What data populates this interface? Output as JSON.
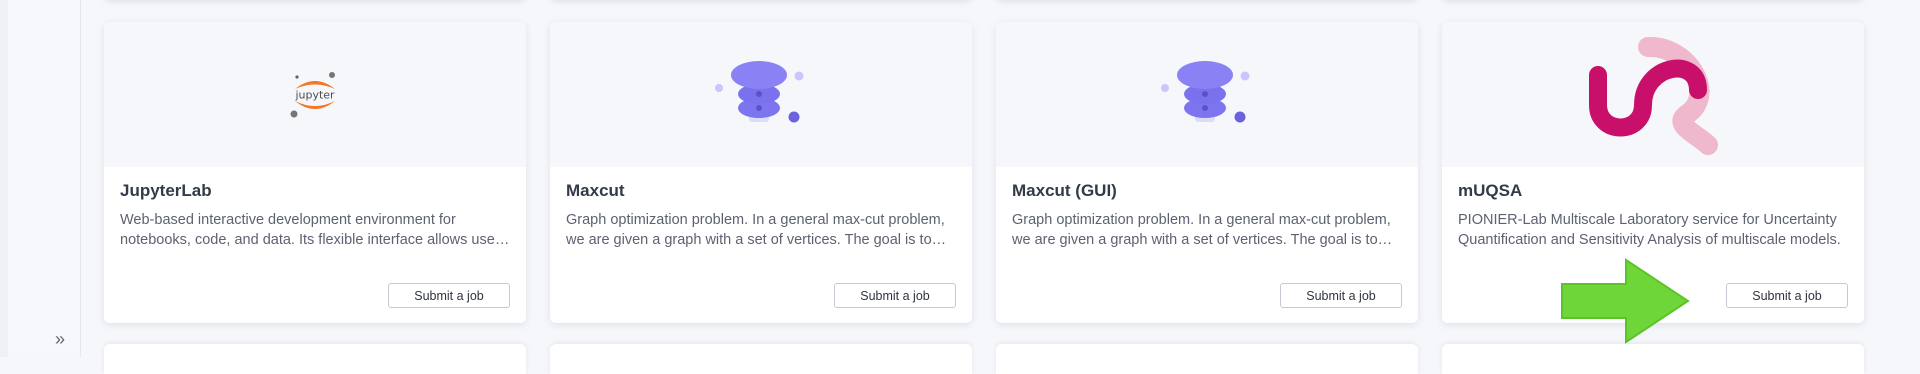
{
  "sidebar": {
    "expand_icon": "double-chevron-right-icon",
    "expand_glyph": "»"
  },
  "cards": [
    {
      "title": "JupyterLab",
      "description": "Web-based interactive development environment for notebooks, code, and data. Its flexible interface allows users to configure and arrange workflows.",
      "logo_text": "jupyter",
      "button_label": "Submit a job",
      "icon": "jupyter-logo-icon"
    },
    {
      "title": "Maxcut",
      "description": "Graph optimization problem. In a general max-cut problem, we are given a graph with a set of vertices. The goal is to partition them.",
      "button_label": "Submit a job",
      "icon": "quantum-stack-icon"
    },
    {
      "title": "Maxcut (GUI)",
      "description": "Graph optimization problem. In a general max-cut problem, we are given a graph with a set of vertices. The goal is to partition them.",
      "button_label": "Submit a job",
      "icon": "quantum-stack-icon"
    },
    {
      "title": "mUQSA",
      "description": "PIONIER-Lab Multiscale Laboratory service for Uncertainty Quantification and Sensitivity Analysis of multiscale models.",
      "button_label": "Submit a job",
      "icon": "muqsa-logo-icon"
    }
  ],
  "annotation": {
    "icon": "green-arrow-icon",
    "color": "#6fd63a"
  },
  "colors": {
    "accent_purple": "#7d74f0",
    "jupyter_orange": "#f37726",
    "muqsa_magenta": "#c8106b"
  }
}
